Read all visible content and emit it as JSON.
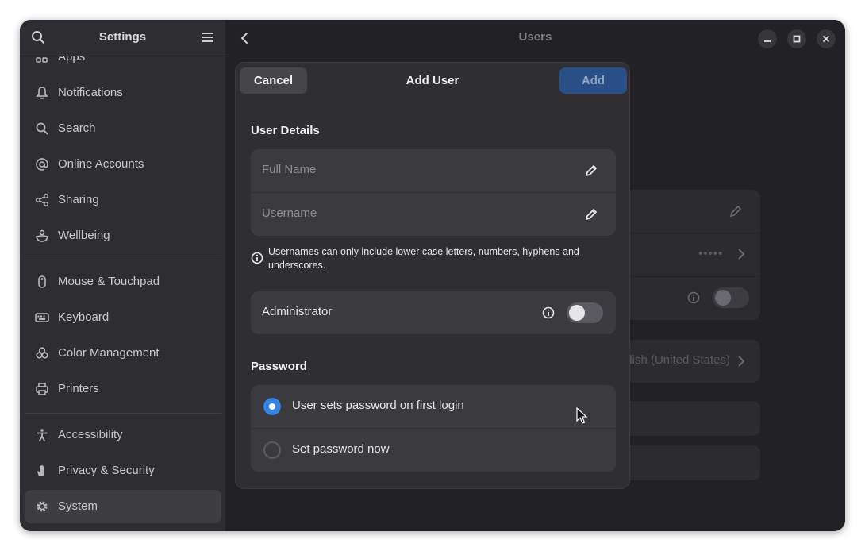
{
  "sidebar": {
    "title": "Settings",
    "items": [
      {
        "label": "Apps",
        "icon": "apps-icon"
      },
      {
        "label": "Notifications",
        "icon": "bell-icon"
      },
      {
        "label": "Search",
        "icon": "search-icon"
      },
      {
        "label": "Online Accounts",
        "icon": "at-sign-icon"
      },
      {
        "label": "Sharing",
        "icon": "share-icon"
      },
      {
        "label": "Wellbeing",
        "icon": "wellbeing-icon"
      },
      {
        "label": "Mouse & Touchpad",
        "icon": "mouse-icon"
      },
      {
        "label": "Keyboard",
        "icon": "keyboard-icon"
      },
      {
        "label": "Color Management",
        "icon": "color-icon"
      },
      {
        "label": "Printers",
        "icon": "printer-icon"
      },
      {
        "label": "Accessibility",
        "icon": "accessibility-icon"
      },
      {
        "label": "Privacy & Security",
        "icon": "hand-icon"
      },
      {
        "label": "System",
        "icon": "gear-icon",
        "selected": true
      }
    ]
  },
  "content": {
    "title": "Users",
    "background_language": "lish (United States)",
    "password_dots": "•••••"
  },
  "dialog": {
    "title": "Add User",
    "cancel_label": "Cancel",
    "add_label": "Add",
    "user_details_label": "User Details",
    "full_name_placeholder": "Full Name",
    "username_placeholder": "Username",
    "username_hint": "Usernames can only include lower case letters, numbers, hyphens and underscores.",
    "administrator_label": "Administrator",
    "administrator_enabled": false,
    "password_label": "Password",
    "password_options": [
      {
        "label": "User sets password on first login",
        "selected": true
      },
      {
        "label": "Set password now",
        "selected": false
      }
    ]
  },
  "colors": {
    "accent": "#3584e4",
    "add_button": "#2a4f86"
  }
}
